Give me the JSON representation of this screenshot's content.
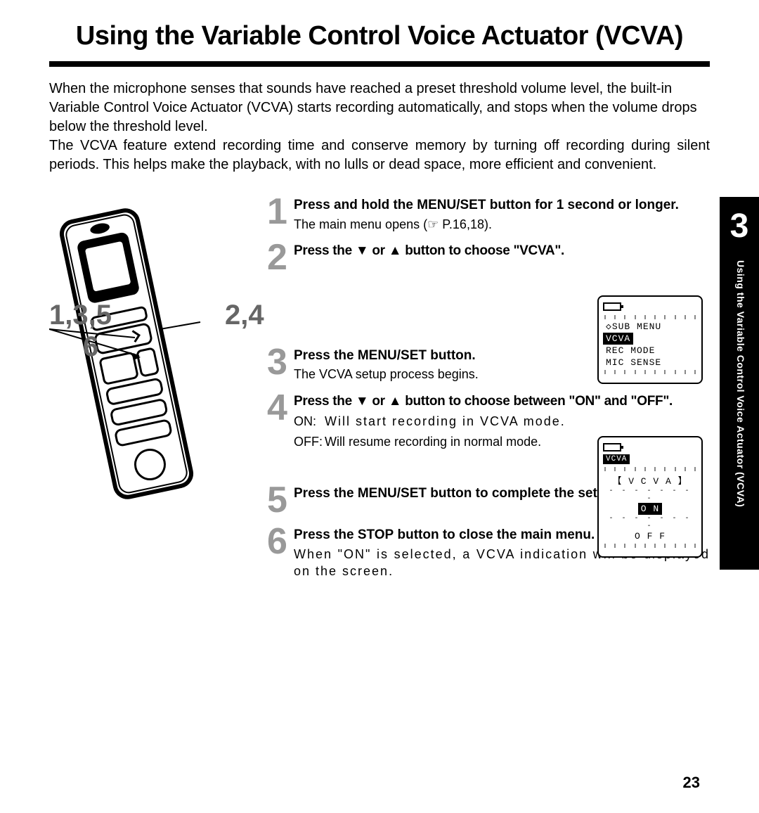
{
  "title": "Using the Variable Control Voice Actuator (VCVA)",
  "intro_p1": "When the microphone senses that sounds have reached a preset threshold volume level, the built-in Variable Control Voice Actuator (VCVA) starts recording automatically, and stops when the volume drops below the threshold level.",
  "intro_p2": "The VCVA feature extend recording time and conserve memory by turning off recording during silent periods. This helps make the playback, with no lulls or dead space, more efficient and convenient.",
  "callouts": {
    "left_top": "1,3,5",
    "left_bottom": "6",
    "right": "2,4"
  },
  "steps": [
    {
      "num": "1",
      "title_pre": "Press and hold the ",
      "title_bold": "MENU/SET",
      "title_post": " button for 1 second or longer.",
      "text": "The main menu opens (☞ P.16,18)."
    },
    {
      "num": "2",
      "title_pre": "Press the ",
      "title_mid": "▼",
      "title_mid2": " or ",
      "title_mid3": "▲",
      "title_post": " button to choose \"VCVA\"."
    },
    {
      "num": "3",
      "title_pre": "Press the ",
      "title_bold": "MENU/SET",
      "title_post": " button.",
      "text": "The VCVA setup process begins."
    },
    {
      "num": "4",
      "title_pre": "Press the ",
      "title_mid": "▼",
      "title_mid2": " or ",
      "title_mid3": "▲",
      "title_post": " button to choose between \"ON\" and \"OFF\".",
      "on_label": "ON:",
      "on_text": "Will start recording in VCVA mode.",
      "off_label": "OFF:",
      "off_text": "Will resume recording in normal mode."
    },
    {
      "num": "5",
      "title_pre": "Press the ",
      "title_bold": "MENU/SET",
      "title_post": " button to complete the setup screen."
    },
    {
      "num": "6",
      "title_pre": "Press the ",
      "title_bold": "STOP",
      "title_post": " button to close the main menu.",
      "text": "When \"ON\" is selected, a VCVA indication will be displayed on the screen."
    }
  ],
  "side_tab": {
    "chapter": "3",
    "label": "Using the Variable Control Voice Actuator (VCVA)"
  },
  "lcd1": {
    "line1": "◇SUB MENU",
    "line2_sel": "VCVA",
    "line3": "REC MODE",
    "line4": "MIC SENSE"
  },
  "lcd2": {
    "badge": "VCVA",
    "line1": "【 V C V A 】",
    "line2_sel": "O N",
    "line3": "O F F"
  },
  "page_number": "23"
}
